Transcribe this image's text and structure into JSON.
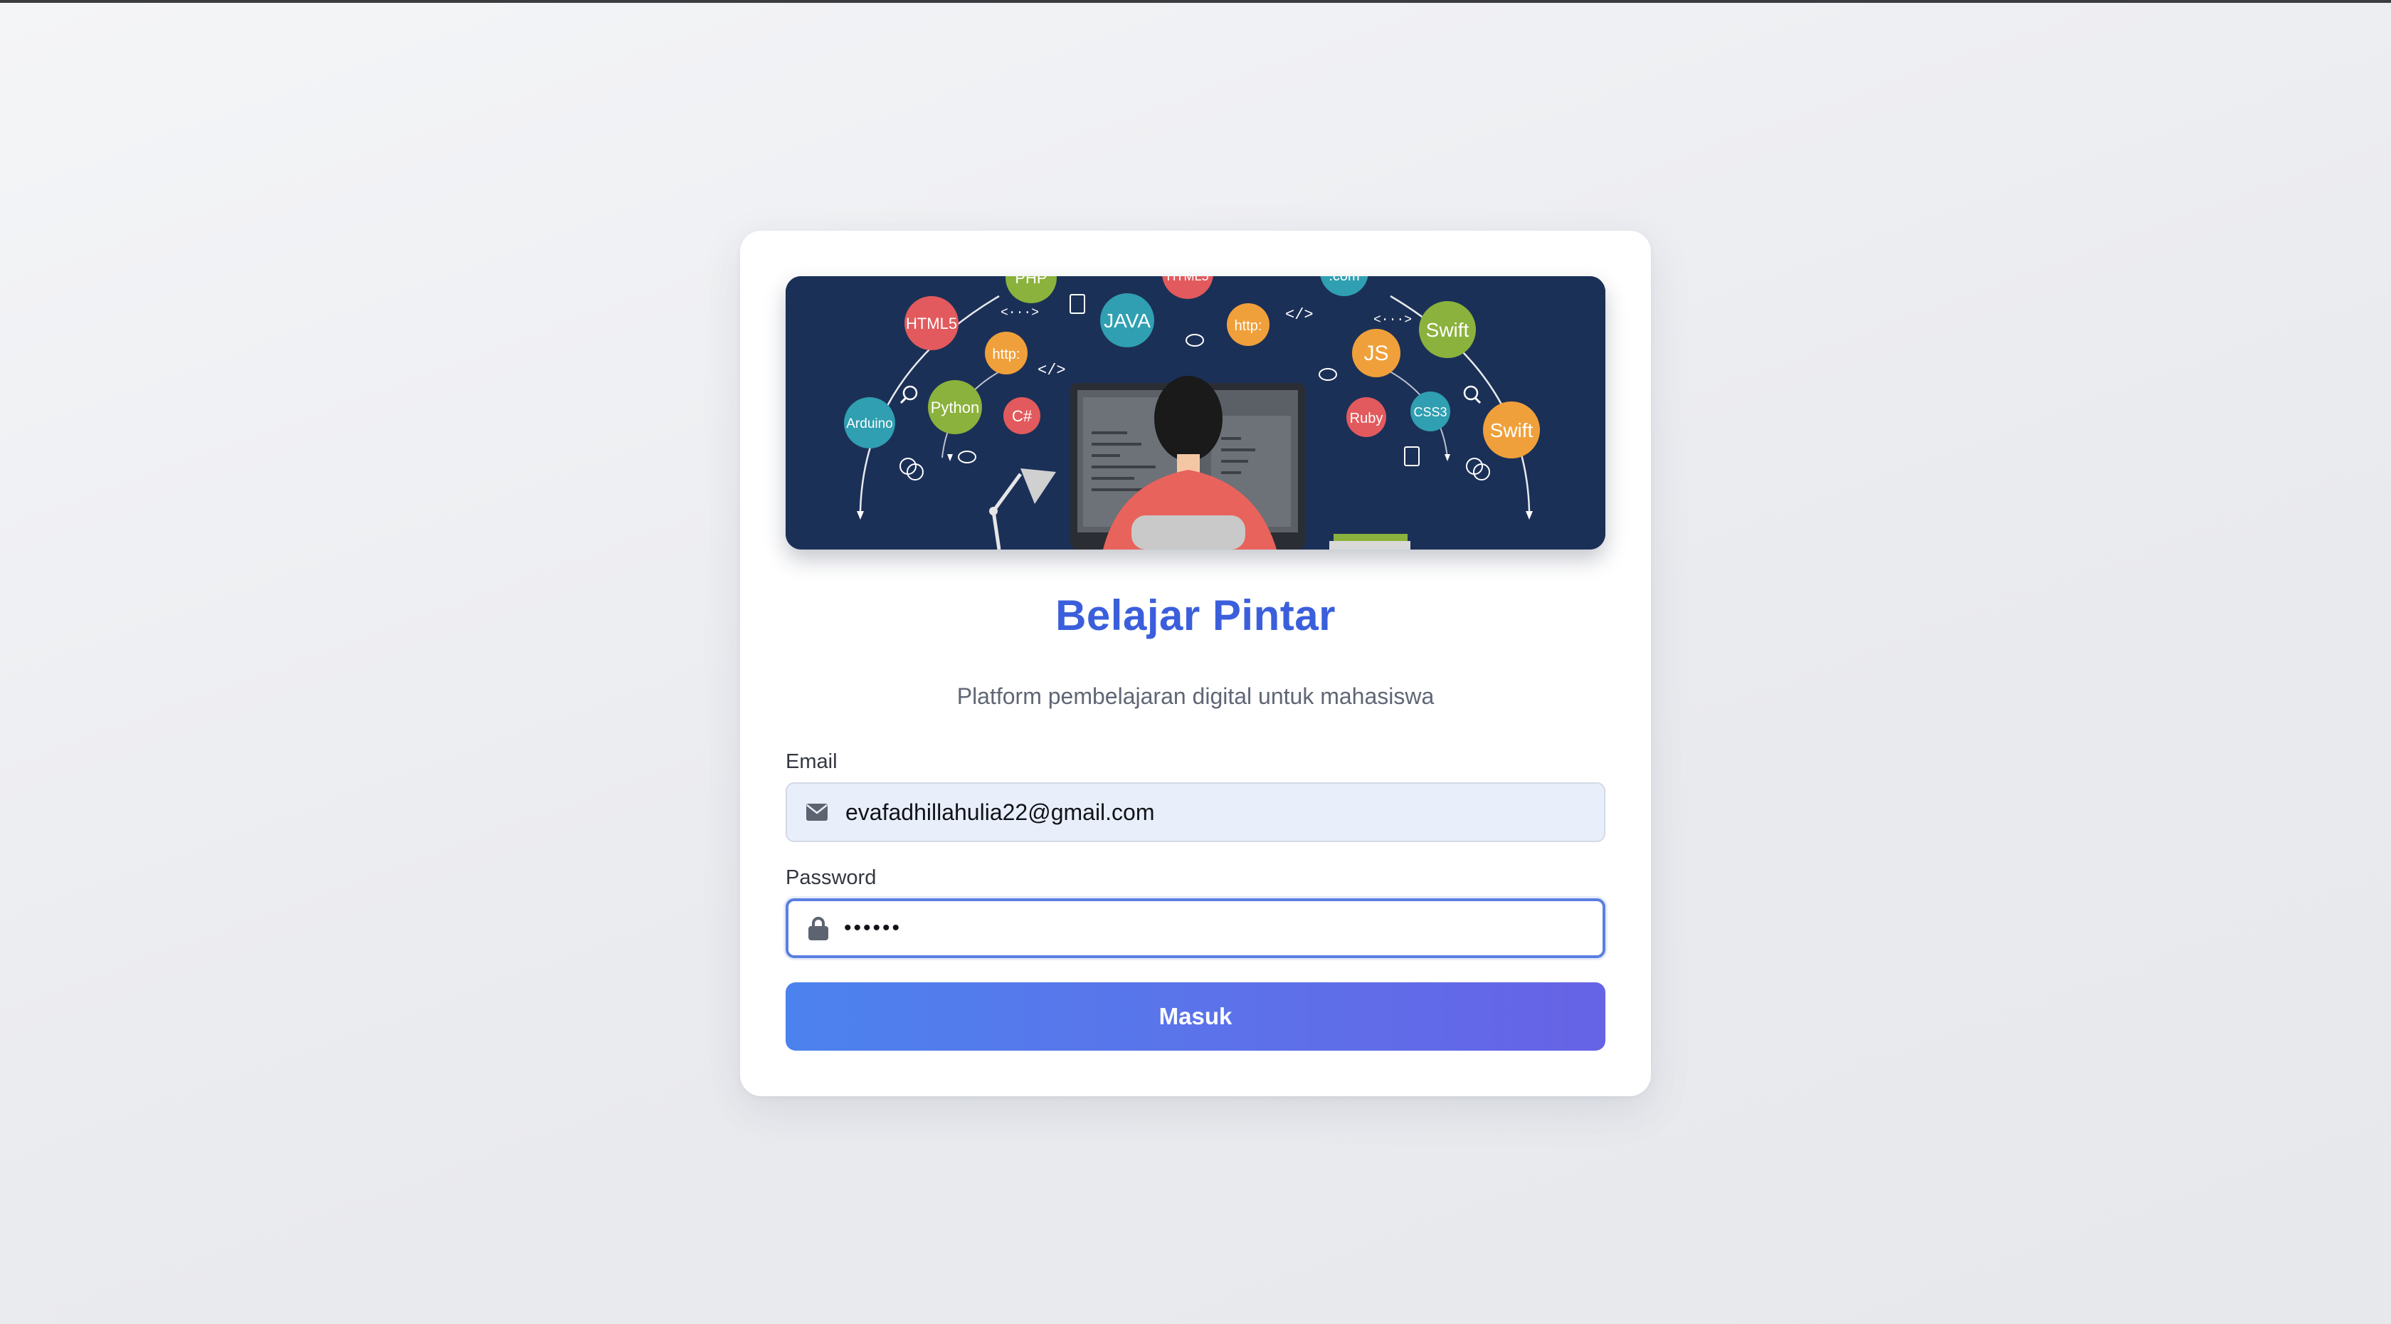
{
  "app": {
    "title": "Belajar Pintar",
    "subtitle": "Platform pembelajaran digital untuk mahasiswa"
  },
  "banner": {
    "bubbles": [
      "PHP",
      "HTML5",
      "JAVA",
      "HTML5",
      ".com",
      "Swift",
      "http:",
      "http:",
      "JS",
      "Arduino",
      "Python",
      "C#",
      "Ruby",
      "CSS3",
      "Swift"
    ],
    "symbols": [
      "<···>",
      "</>",
      "</>",
      "<···>",
      "</>"
    ]
  },
  "form": {
    "email_label": "Email",
    "email_value": "evafadhillahulia22@gmail.com",
    "password_label": "Password",
    "password_value": "••••••",
    "submit_label": "Masuk"
  },
  "colors": {
    "accent": "#3b5fdc",
    "banner_bg": "#1b3057",
    "button_start": "#4c82ee",
    "button_end": "#6663e6"
  },
  "icons": {
    "email": "envelope-icon",
    "password": "lock-icon"
  }
}
